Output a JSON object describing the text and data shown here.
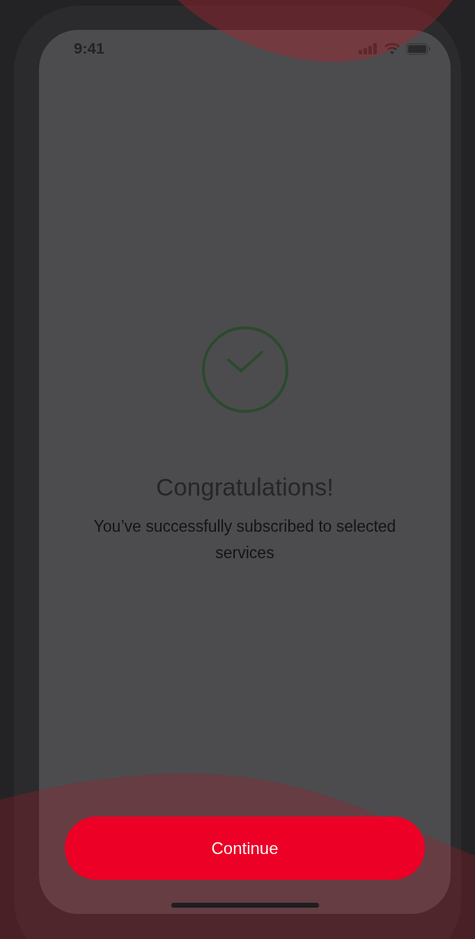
{
  "status_bar": {
    "time": "9:41"
  },
  "message": {
    "title": "Congratulations!",
    "subtitle": "You’ve successfully subscribed to selected services"
  },
  "buttons": [
    {
      "label": "Continue",
      "kind": "primary"
    }
  ]
}
